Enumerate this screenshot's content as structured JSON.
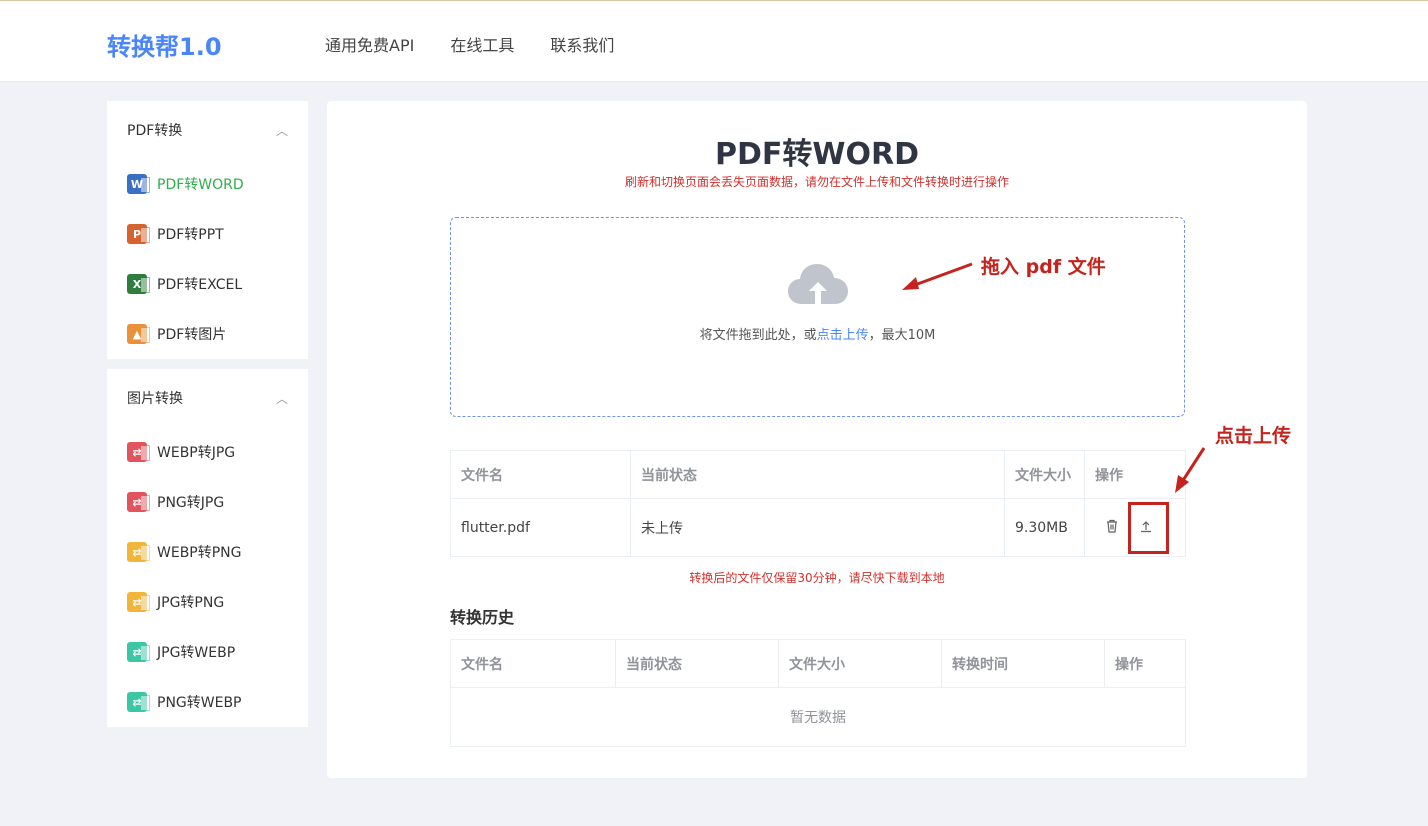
{
  "header": {
    "logo": "转换帮1.0",
    "nav": [
      "通用免费API",
      "在线工具",
      "联系我们"
    ]
  },
  "sidebar": {
    "groups": [
      {
        "title": "PDF转换",
        "items": [
          {
            "label": "PDF转WORD",
            "icon": "word-file-icon",
            "active": true
          },
          {
            "label": "PDF转PPT",
            "icon": "ppt-file-icon"
          },
          {
            "label": "PDF转EXCEL",
            "icon": "excel-file-icon"
          },
          {
            "label": "PDF转图片",
            "icon": "image-file-icon"
          }
        ]
      },
      {
        "title": "图片转换",
        "items": [
          {
            "label": "WEBP转JPG",
            "icon": "image-convert-icon"
          },
          {
            "label": "PNG转JPG",
            "icon": "image-convert-icon"
          },
          {
            "label": "WEBP转PNG",
            "icon": "image-convert-icon"
          },
          {
            "label": "JPG转PNG",
            "icon": "image-convert-icon"
          },
          {
            "label": "JPG转WEBP",
            "icon": "image-convert-icon"
          },
          {
            "label": "PNG转WEBP",
            "icon": "image-convert-icon"
          }
        ]
      }
    ]
  },
  "main": {
    "title": "PDF转WORD",
    "warning": "刷新和切换页面会丢失页面数据，请勿在文件上传和文件转换时进行操作",
    "dropzone": {
      "text_before": "将文件拖到此处，或",
      "link": "点击上传",
      "text_after": "，最大10M"
    },
    "file_table": {
      "headers": [
        "文件名",
        "当前状态",
        "文件大小",
        "操作"
      ],
      "rows": [
        {
          "name": "flutter.pdf",
          "status": "未上传",
          "size": "9.30MB"
        }
      ]
    },
    "retention_note": "转换后的文件仅保留30分钟，请尽快下载到本地",
    "history": {
      "title": "转换历史",
      "headers": [
        "文件名",
        "当前状态",
        "文件大小",
        "转换时间",
        "操作"
      ],
      "empty": "暂无数据"
    }
  },
  "annotations": {
    "drag_label": "拖入 pdf 文件",
    "upload_label": "点击上传"
  },
  "colors": {
    "brand": "#4a86f7",
    "active": "#2fae4a",
    "warning": "#d0312d",
    "annotation": "#c4231e"
  }
}
